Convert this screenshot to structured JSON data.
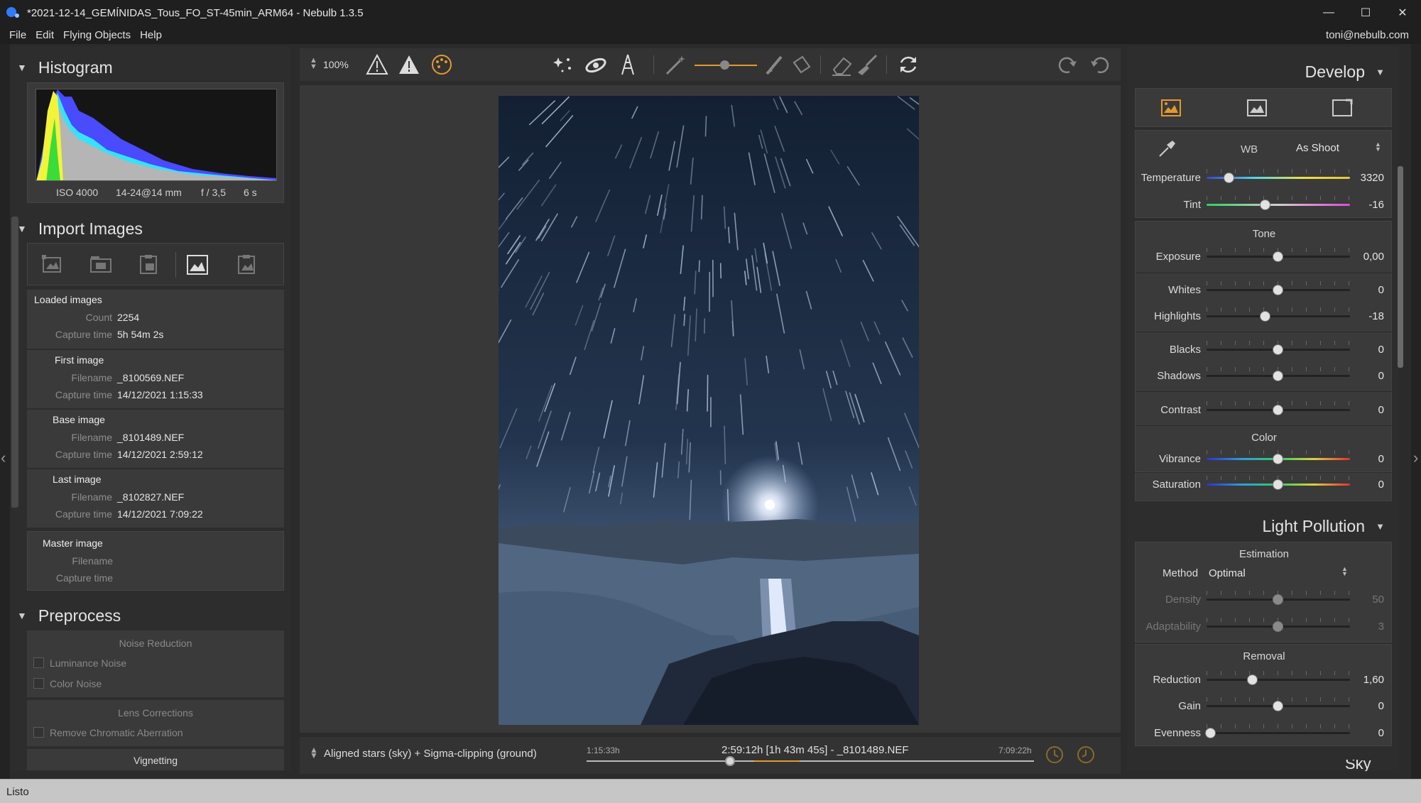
{
  "window": {
    "title": "*2021-12-14_GEMÍNIDAS_Tous_FO_ST-45min_ARM64 - Nebulb 1.3.5"
  },
  "menu": {
    "items": [
      "File",
      "Edit",
      "Flying Objects",
      "Help"
    ],
    "user": "toni@nebulb.com"
  },
  "histogram": {
    "title": "Histogram",
    "iso": "ISO 4000",
    "lens": "14-24@14 mm",
    "aperture": "f / 3,5",
    "exposure": "6 s"
  },
  "import": {
    "title": "Import Images",
    "loaded": {
      "title": "Loaded images",
      "count_label": "Count",
      "count": "2254",
      "capture_label": "Capture time",
      "capture": "5h 54m 2s"
    },
    "first": {
      "title": "First image",
      "filename_label": "Filename",
      "filename": "_8100569.NEF",
      "capture_label": "Capture time",
      "capture": "14/12/2021 1:15:33"
    },
    "base": {
      "title": "Base image",
      "filename_label": "Filename",
      "filename": "_8101489.NEF",
      "capture_label": "Capture time",
      "capture": "14/12/2021 2:59:12"
    },
    "last": {
      "title": "Last image",
      "filename_label": "Filename",
      "filename": "_8102827.NEF",
      "capture_label": "Capture time",
      "capture": "14/12/2021 7:09:22"
    },
    "master": {
      "title": "Master image",
      "filename_label": "Filename",
      "capture_label": "Capture time"
    }
  },
  "preprocess": {
    "title": "Preprocess",
    "noise_title": "Noise Reduction",
    "luminance": "Luminance Noise",
    "color": "Color Noise",
    "lens_title": "Lens Corrections",
    "chromatic": "Remove Chromatic Aberration",
    "vignetting": "Vignetting"
  },
  "toolbar": {
    "zoom": "100%"
  },
  "timeline": {
    "mode": "Aligned stars (sky) + Sigma-clipping (ground)",
    "start": "1:15:33h",
    "end": "7:09:22h",
    "center": "2:59:12h [1h 43m 45s] - _8101489.NEF",
    "position": 0.32
  },
  "develop": {
    "title": "Develop",
    "wb_label": "WB",
    "wb_value": "As Shoot",
    "temperature": {
      "label": "Temperature",
      "value": "3320",
      "pos": 0.16
    },
    "tint": {
      "label": "Tint",
      "value": "-16",
      "pos": 0.41
    },
    "tone_title": "Tone",
    "exposure": {
      "label": "Exposure",
      "value": "0,00",
      "pos": 0.5
    },
    "whites": {
      "label": "Whites",
      "value": "0",
      "pos": 0.5
    },
    "highlights": {
      "label": "Highlights",
      "value": "-18",
      "pos": 0.41
    },
    "blacks": {
      "label": "Blacks",
      "value": "0",
      "pos": 0.5
    },
    "shadows": {
      "label": "Shadows",
      "value": "0",
      "pos": 0.5
    },
    "contrast": {
      "label": "Contrast",
      "value": "0",
      "pos": 0.5
    },
    "color_title": "Color",
    "vibrance": {
      "label": "Vibrance",
      "value": "0",
      "pos": 0.5
    },
    "saturation": {
      "label": "Saturation",
      "value": "0",
      "pos": 0.5
    }
  },
  "light_pollution": {
    "title": "Light Pollution",
    "estimation_title": "Estimation",
    "method_label": "Method",
    "method_value": "Optimal",
    "density": {
      "label": "Density",
      "value": "50",
      "pos": 0.5
    },
    "adaptability": {
      "label": "Adaptability",
      "value": "3",
      "pos": 0.5
    },
    "removal_title": "Removal",
    "reduction": {
      "label": "Reduction",
      "value": "1,60",
      "pos": 0.32
    },
    "gain": {
      "label": "Gain",
      "value": "0",
      "pos": 0.5
    },
    "evenness": {
      "label": "Evenness",
      "value": "0",
      "pos": 0.03
    },
    "next_title": "Sky"
  },
  "status": {
    "text": "Listo"
  },
  "colors": {
    "accent": "#e29a2e",
    "panel": "#3a3a3a",
    "background": "#2b2b2b"
  }
}
